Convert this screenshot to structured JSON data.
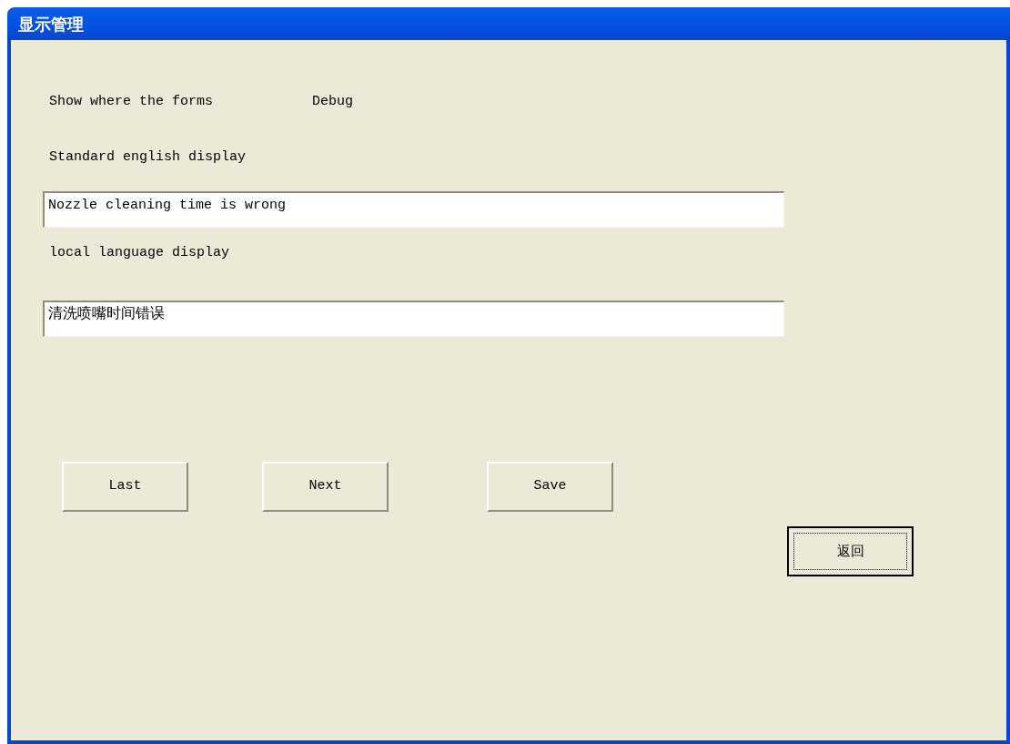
{
  "window": {
    "title": "显示管理"
  },
  "header": {
    "label": "Show where the forms",
    "value": "Debug"
  },
  "english": {
    "label": "Standard english display",
    "value": "Nozzle cleaning time is wrong"
  },
  "local": {
    "label": "local language display",
    "value": "清洗喷嘴时间错误"
  },
  "buttons": [
    {
      "label": "Last",
      "default": false
    },
    {
      "label": "Next",
      "default": false
    },
    {
      "label": "Save",
      "default": false
    }
  ],
  "back_button": {
    "label": "返回",
    "default": true
  }
}
